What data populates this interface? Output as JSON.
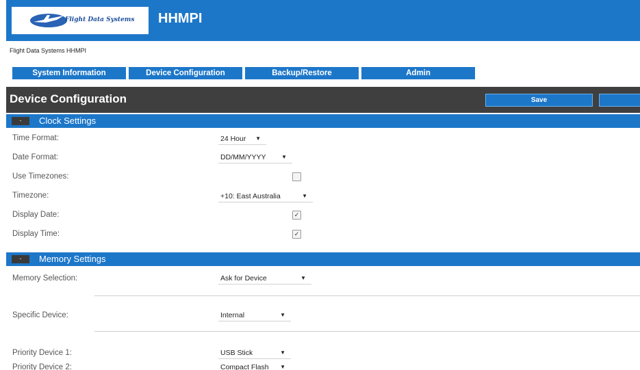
{
  "header": {
    "logo_text": "Flight Data Systems",
    "app_name": "HHMPI"
  },
  "subtitle": "Flight Data Systems HHMPI",
  "nav": {
    "tabs": [
      {
        "label": "System Information"
      },
      {
        "label": "Device Configuration"
      },
      {
        "label": "Backup/Restore"
      },
      {
        "label": "Admin"
      }
    ]
  },
  "page": {
    "title": "Device Configuration",
    "save_label": "Save"
  },
  "clock_settings": {
    "title": "Clock Settings",
    "toggle": "-",
    "time_format": {
      "label": "Time Format:",
      "value": "24 Hour"
    },
    "date_format": {
      "label": "Date Format:",
      "value": "DD/MM/YYYY"
    },
    "use_timezones": {
      "label": "Use Timezones:",
      "checked": false
    },
    "timezone": {
      "label": "Timezone:",
      "value": "+10: East Australia"
    },
    "display_date": {
      "label": "Display Date:",
      "checked": true
    },
    "display_time": {
      "label": "Display Time:",
      "checked": true
    }
  },
  "memory_settings": {
    "title": "Memory Settings",
    "toggle": "-",
    "memory_selection": {
      "label": "Memory Selection:",
      "value": "Ask for Device"
    },
    "specific_device": {
      "label": "Specific Device:",
      "value": "Internal"
    },
    "priority_device_1": {
      "label": "Priority Device 1:",
      "value": "USB Stick"
    },
    "priority_device_2": {
      "label": "Priority Device 2:",
      "value": "Compact Flash"
    }
  },
  "icons": {
    "logo": "airplane-logo-icon",
    "dropdown": "chevron-down-icon",
    "check": "checkmark-icon"
  },
  "colors": {
    "brand_blue": "#1d77c9",
    "header_dark": "#3f3f3f"
  }
}
